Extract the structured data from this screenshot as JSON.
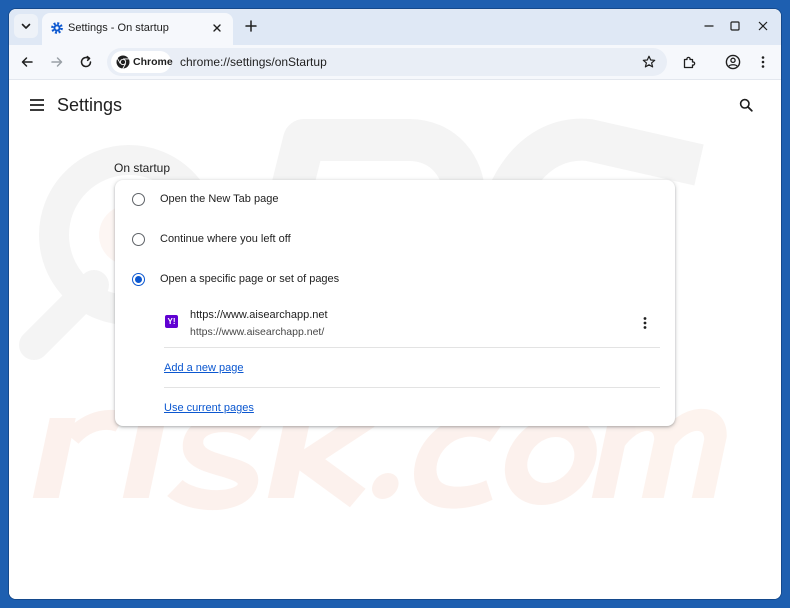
{
  "tab": {
    "title": "Settings - On startup"
  },
  "toolbar": {
    "chip_label": "Chrome",
    "url": "chrome://settings/onStartup"
  },
  "settings": {
    "title": "Settings",
    "section_title": "On startup",
    "options": [
      {
        "label": "Open the New Tab page",
        "checked": false
      },
      {
        "label": "Continue where you left off",
        "checked": false
      },
      {
        "label": "Open a specific page or set of pages",
        "checked": true
      }
    ],
    "page_entry": {
      "title": "https://www.aisearchapp.net",
      "url": "https://www.aisearchapp.net/",
      "favicon_text": "Y!"
    },
    "add_page_link": "Add a new page",
    "use_current_link": "Use current pages"
  },
  "colors": {
    "accent": "#0b57d0",
    "desktop": "#1e5fb0",
    "favicon": "#6001d2"
  }
}
